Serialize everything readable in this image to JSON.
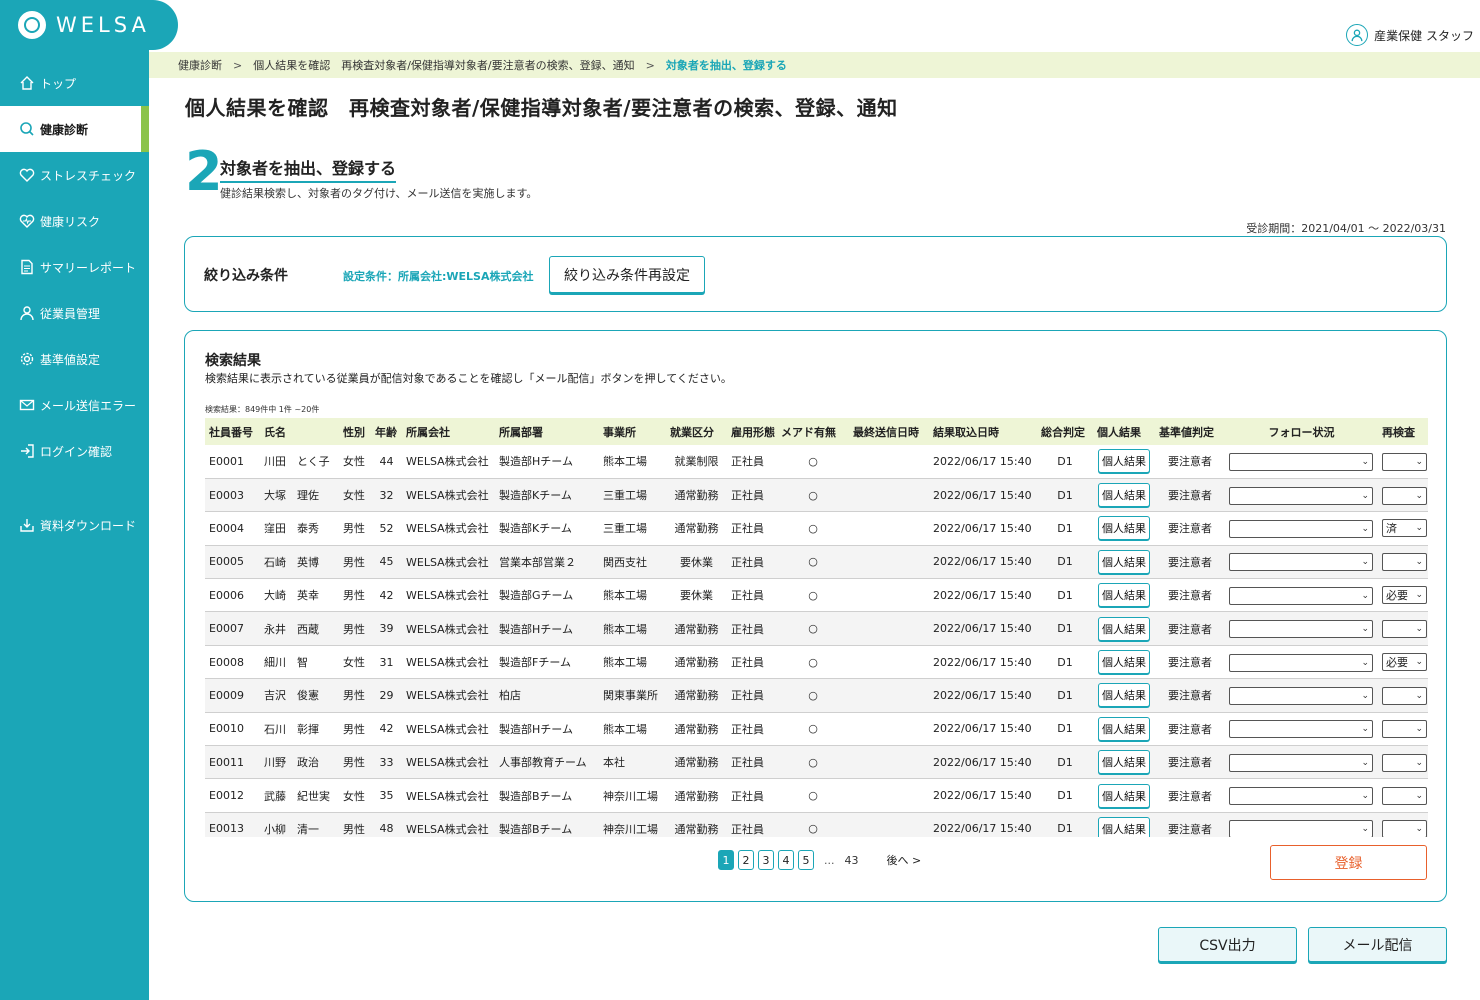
{
  "brand": {
    "name": "WELSA"
  },
  "user": {
    "role": "産業保健 スタッフ"
  },
  "sidebar": {
    "items": [
      {
        "label": "トップ",
        "icon": "home-icon"
      },
      {
        "label": "健康診断",
        "icon": "search-icon"
      },
      {
        "label": "ストレスチェック",
        "icon": "heart-icon"
      },
      {
        "label": "健康リスク",
        "icon": "heart-risk-icon"
      },
      {
        "label": "サマリーレポート",
        "icon": "document-icon"
      },
      {
        "label": "従業員管理",
        "icon": "person-icon"
      },
      {
        "label": "基準値設定",
        "icon": "gear-icon"
      },
      {
        "label": "メール送信エラー",
        "icon": "mail-icon"
      },
      {
        "label": "ログイン確認",
        "icon": "login-icon"
      },
      {
        "label": "資料ダウンロード",
        "icon": "download-icon"
      }
    ]
  },
  "breadcrumb": {
    "items": [
      "健康診断",
      "個人結果を確認　再検査対象者/保健指導対象者/要注意者の検索、登録、通知"
    ],
    "current": "対象者を抽出、登録する"
  },
  "page": {
    "title": "個人結果を確認　再検査対象者/保健指導対象者/要注意者の検索、登録、通知",
    "step_number": "2",
    "step_title": "対象者を抽出、登録する",
    "step_desc": "健診結果検索し、対象者のタグ付け、メール送信を実施します。",
    "period": "受診期間：2021/04/01 〜 2022/03/31"
  },
  "filter": {
    "label": "絞り込み条件",
    "condition": "設定条件：所属会社:WELSA株式会社",
    "reset_label": "絞り込み条件再設定"
  },
  "results": {
    "title": "検索結果",
    "desc": "検索結果に表示されている従業員が配信対象であることを確認し「メール配信」ボタンを押してください。",
    "count": "検索結果：849件中 1件 ~20件",
    "columns": [
      "社員番号",
      "氏名",
      "性別",
      "年齢",
      "所属会社",
      "所属部署",
      "事業所",
      "就業区分",
      "雇用形態",
      "メアド有無",
      "最終送信日時",
      "結果取込日時",
      "総合判定",
      "個人結果",
      "基準値判定",
      "フォロー状況",
      "再検査"
    ],
    "rows": [
      {
        "id": "E0001",
        "name": "川田　とく子",
        "gender": "女性",
        "age": "44",
        "company": "WELSA株式会社",
        "dept": "製造部Hチーム",
        "office": "熊本工場",
        "work": "就業制限",
        "employ": "正社員",
        "email": "○",
        "last_sent": "",
        "imported": "2022/06/17 15:40",
        "judge": "D1",
        "button": "個人結果",
        "std": "要注意者",
        "follow": "",
        "recheck": ""
      },
      {
        "id": "E0003",
        "name": "大塚　理佐",
        "gender": "女性",
        "age": "32",
        "company": "WELSA株式会社",
        "dept": "製造部Kチーム",
        "office": "三重工場",
        "work": "通常勤務",
        "employ": "正社員",
        "email": "○",
        "last_sent": "",
        "imported": "2022/06/17 15:40",
        "judge": "D1",
        "button": "個人結果",
        "std": "要注意者",
        "follow": "",
        "recheck": ""
      },
      {
        "id": "E0004",
        "name": "窪田　泰秀",
        "gender": "男性",
        "age": "52",
        "company": "WELSA株式会社",
        "dept": "製造部Kチーム",
        "office": "三重工場",
        "work": "通常勤務",
        "employ": "正社員",
        "email": "○",
        "last_sent": "",
        "imported": "2022/06/17 15:40",
        "judge": "D1",
        "button": "個人結果",
        "std": "要注意者",
        "follow": "",
        "recheck": "済"
      },
      {
        "id": "E0005",
        "name": "石崎　英博",
        "gender": "男性",
        "age": "45",
        "company": "WELSA株式会社",
        "dept": "営業本部営業２",
        "office": "関西支社",
        "work": "要休業",
        "employ": "正社員",
        "email": "○",
        "last_sent": "",
        "imported": "2022/06/17 15:40",
        "judge": "D1",
        "button": "個人結果",
        "std": "要注意者",
        "follow": "",
        "recheck": ""
      },
      {
        "id": "E0006",
        "name": "大崎　英幸",
        "gender": "男性",
        "age": "42",
        "company": "WELSA株式会社",
        "dept": "製造部Gチーム",
        "office": "熊本工場",
        "work": "要休業",
        "employ": "正社員",
        "email": "○",
        "last_sent": "",
        "imported": "2022/06/17 15:40",
        "judge": "D1",
        "button": "個人結果",
        "std": "要注意者",
        "follow": "",
        "recheck": "必要"
      },
      {
        "id": "E0007",
        "name": "永井　西蔵",
        "gender": "男性",
        "age": "39",
        "company": "WELSA株式会社",
        "dept": "製造部Hチーム",
        "office": "熊本工場",
        "work": "通常勤務",
        "employ": "正社員",
        "email": "○",
        "last_sent": "",
        "imported": "2022/06/17 15:40",
        "judge": "D1",
        "button": "個人結果",
        "std": "要注意者",
        "follow": "",
        "recheck": ""
      },
      {
        "id": "E0008",
        "name": "細川　智",
        "gender": "女性",
        "age": "31",
        "company": "WELSA株式会社",
        "dept": "製造部Fチーム",
        "office": "熊本工場",
        "work": "通常勤務",
        "employ": "正社員",
        "email": "○",
        "last_sent": "",
        "imported": "2022/06/17 15:40",
        "judge": "D1",
        "button": "個人結果",
        "std": "要注意者",
        "follow": "",
        "recheck": "必要"
      },
      {
        "id": "E0009",
        "name": "吉沢　俊憲",
        "gender": "男性",
        "age": "29",
        "company": "WELSA株式会社",
        "dept": "柏店",
        "office": "関東事業所",
        "work": "通常勤務",
        "employ": "正社員",
        "email": "○",
        "last_sent": "",
        "imported": "2022/06/17 15:40",
        "judge": "D1",
        "button": "個人結果",
        "std": "要注意者",
        "follow": "",
        "recheck": ""
      },
      {
        "id": "E0010",
        "name": "石川　彰揮",
        "gender": "男性",
        "age": "42",
        "company": "WELSA株式会社",
        "dept": "製造部Hチーム",
        "office": "熊本工場",
        "work": "通常勤務",
        "employ": "正社員",
        "email": "○",
        "last_sent": "",
        "imported": "2022/06/17 15:40",
        "judge": "D1",
        "button": "個人結果",
        "std": "要注意者",
        "follow": "",
        "recheck": ""
      },
      {
        "id": "E0011",
        "name": "川野　政治",
        "gender": "男性",
        "age": "33",
        "company": "WELSA株式会社",
        "dept": "人事部教育チーム",
        "office": "本社",
        "work": "通常勤務",
        "employ": "正社員",
        "email": "○",
        "last_sent": "",
        "imported": "2022/06/17 15:40",
        "judge": "D1",
        "button": "個人結果",
        "std": "要注意者",
        "follow": "",
        "recheck": ""
      },
      {
        "id": "E0012",
        "name": "武藤　紀世実",
        "gender": "女性",
        "age": "35",
        "company": "WELSA株式会社",
        "dept": "製造部Bチーム",
        "office": "神奈川工場",
        "work": "通常勤務",
        "employ": "正社員",
        "email": "○",
        "last_sent": "",
        "imported": "2022/06/17 15:40",
        "judge": "D1",
        "button": "個人結果",
        "std": "要注意者",
        "follow": "",
        "recheck": ""
      },
      {
        "id": "E0013",
        "name": "小柳　清一",
        "gender": "男性",
        "age": "48",
        "company": "WELSA株式会社",
        "dept": "製造部Bチーム",
        "office": "神奈川工場",
        "work": "通常勤務",
        "employ": "正社員",
        "email": "○",
        "last_sent": "",
        "imported": "2022/06/17 15:40",
        "judge": "D1",
        "button": "個人結果",
        "std": "要注意者",
        "follow": "",
        "recheck": ""
      }
    ]
  },
  "pagination": {
    "pages": [
      "1",
      "2",
      "3",
      "4",
      "5"
    ],
    "current": "1",
    "dots": "...",
    "last": "43",
    "next": "後へ >"
  },
  "actions": {
    "register": "登録",
    "csv": "CSV出力",
    "mail": "メール配信"
  },
  "colors": {
    "primary": "#1ba6b7",
    "accent_green": "#8bc34a",
    "breadcrumb_bg": "#eef5d6",
    "register": "#e8602c"
  }
}
